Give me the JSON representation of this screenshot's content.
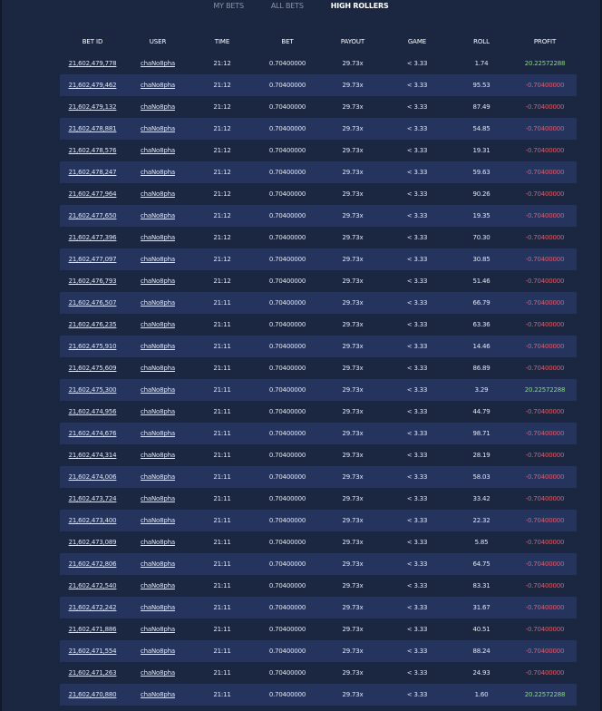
{
  "tabs": [
    {
      "label": "MY BETS",
      "active": false
    },
    {
      "label": "ALL BETS",
      "active": false
    },
    {
      "label": "HIGH ROLLERS",
      "active": true
    }
  ],
  "table": {
    "columns": [
      "BET ID",
      "USER",
      "TIME",
      "BET",
      "PAYOUT",
      "GAME",
      "ROLL",
      "PROFIT"
    ],
    "rows": [
      {
        "bet_id": "21,602,479,778",
        "user": "chaNo8pha",
        "time": "21:12",
        "bet": "0.70400000",
        "payout": "29.73x",
        "game": "< 3.33",
        "roll": "1.74",
        "profit": "20.22572288",
        "win": true
      },
      {
        "bet_id": "21,602,479,462",
        "user": "chaNo8pha",
        "time": "21:12",
        "bet": "0.70400000",
        "payout": "29.73x",
        "game": "< 3.33",
        "roll": "95.53",
        "profit": "-0.70400000",
        "win": false
      },
      {
        "bet_id": "21,602,479,132",
        "user": "chaNo8pha",
        "time": "21:12",
        "bet": "0.70400000",
        "payout": "29.73x",
        "game": "< 3.33",
        "roll": "87.49",
        "profit": "-0.70400000",
        "win": false
      },
      {
        "bet_id": "21,602,478,881",
        "user": "chaNo8pha",
        "time": "21:12",
        "bet": "0.70400000",
        "payout": "29.73x",
        "game": "< 3.33",
        "roll": "54.85",
        "profit": "-0.70400000",
        "win": false
      },
      {
        "bet_id": "21,602,478,576",
        "user": "chaNo8pha",
        "time": "21:12",
        "bet": "0.70400000",
        "payout": "29.73x",
        "game": "< 3.33",
        "roll": "19.31",
        "profit": "-0.70400000",
        "win": false
      },
      {
        "bet_id": "21,602,478,247",
        "user": "chaNo8pha",
        "time": "21:12",
        "bet": "0.70400000",
        "payout": "29.73x",
        "game": "< 3.33",
        "roll": "59.63",
        "profit": "-0.70400000",
        "win": false
      },
      {
        "bet_id": "21,602,477,964",
        "user": "chaNo8pha",
        "time": "21:12",
        "bet": "0.70400000",
        "payout": "29.73x",
        "game": "< 3.33",
        "roll": "90.26",
        "profit": "-0.70400000",
        "win": false
      },
      {
        "bet_id": "21,602,477,650",
        "user": "chaNo8pha",
        "time": "21:12",
        "bet": "0.70400000",
        "payout": "29.73x",
        "game": "< 3.33",
        "roll": "19.35",
        "profit": "-0.70400000",
        "win": false
      },
      {
        "bet_id": "21,602,477,396",
        "user": "chaNo8pha",
        "time": "21:12",
        "bet": "0.70400000",
        "payout": "29.73x",
        "game": "< 3.33",
        "roll": "70.30",
        "profit": "-0.70400000",
        "win": false
      },
      {
        "bet_id": "21,602,477,097",
        "user": "chaNo8pha",
        "time": "21:12",
        "bet": "0.70400000",
        "payout": "29.73x",
        "game": "< 3.33",
        "roll": "30.85",
        "profit": "-0.70400000",
        "win": false
      },
      {
        "bet_id": "21,602,476,793",
        "user": "chaNo8pha",
        "time": "21:12",
        "bet": "0.70400000",
        "payout": "29.73x",
        "game": "< 3.33",
        "roll": "51.46",
        "profit": "-0.70400000",
        "win": false
      },
      {
        "bet_id": "21,602,476,507",
        "user": "chaNo8pha",
        "time": "21:11",
        "bet": "0.70400000",
        "payout": "29.73x",
        "game": "< 3.33",
        "roll": "66.79",
        "profit": "-0.70400000",
        "win": false
      },
      {
        "bet_id": "21,602,476,235",
        "user": "chaNo8pha",
        "time": "21:11",
        "bet": "0.70400000",
        "payout": "29.73x",
        "game": "< 3.33",
        "roll": "63.36",
        "profit": "-0.70400000",
        "win": false
      },
      {
        "bet_id": "21,602,475,910",
        "user": "chaNo8pha",
        "time": "21:11",
        "bet": "0.70400000",
        "payout": "29.73x",
        "game": "< 3.33",
        "roll": "14.46",
        "profit": "-0.70400000",
        "win": false
      },
      {
        "bet_id": "21,602,475,609",
        "user": "chaNo8pha",
        "time": "21:11",
        "bet": "0.70400000",
        "payout": "29.73x",
        "game": "< 3.33",
        "roll": "86.89",
        "profit": "-0.70400000",
        "win": false
      },
      {
        "bet_id": "21,602,475,300",
        "user": "chaNo8pha",
        "time": "21:11",
        "bet": "0.70400000",
        "payout": "29.73x",
        "game": "< 3.33",
        "roll": "3.29",
        "profit": "20.22572288",
        "win": true
      },
      {
        "bet_id": "21,602,474,956",
        "user": "chaNo8pha",
        "time": "21:11",
        "bet": "0.70400000",
        "payout": "29.73x",
        "game": "< 3.33",
        "roll": "44.79",
        "profit": "-0.70400000",
        "win": false
      },
      {
        "bet_id": "21,602,474,676",
        "user": "chaNo8pha",
        "time": "21:11",
        "bet": "0.70400000",
        "payout": "29.73x",
        "game": "< 3.33",
        "roll": "98.71",
        "profit": "-0.70400000",
        "win": false
      },
      {
        "bet_id": "21,602,474,314",
        "user": "chaNo8pha",
        "time": "21:11",
        "bet": "0.70400000",
        "payout": "29.73x",
        "game": "< 3.33",
        "roll": "28.19",
        "profit": "-0.70400000",
        "win": false
      },
      {
        "bet_id": "21,602,474,006",
        "user": "chaNo8pha",
        "time": "21:11",
        "bet": "0.70400000",
        "payout": "29.73x",
        "game": "< 3.33",
        "roll": "58.03",
        "profit": "-0.70400000",
        "win": false
      },
      {
        "bet_id": "21,602,473,724",
        "user": "chaNo8pha",
        "time": "21:11",
        "bet": "0.70400000",
        "payout": "29.73x",
        "game": "< 3.33",
        "roll": "33.42",
        "profit": "-0.70400000",
        "win": false
      },
      {
        "bet_id": "21,602,473,400",
        "user": "chaNo8pha",
        "time": "21:11",
        "bet": "0.70400000",
        "payout": "29.73x",
        "game": "< 3.33",
        "roll": "22.32",
        "profit": "-0.70400000",
        "win": false
      },
      {
        "bet_id": "21,602,473,089",
        "user": "chaNo8pha",
        "time": "21:11",
        "bet": "0.70400000",
        "payout": "29.73x",
        "game": "< 3.33",
        "roll": "5.85",
        "profit": "-0.70400000",
        "win": false
      },
      {
        "bet_id": "21,602,472,806",
        "user": "chaNo8pha",
        "time": "21:11",
        "bet": "0.70400000",
        "payout": "29.73x",
        "game": "< 3.33",
        "roll": "64.75",
        "profit": "-0.70400000",
        "win": false
      },
      {
        "bet_id": "21,602,472,540",
        "user": "chaNo8pha",
        "time": "21:11",
        "bet": "0.70400000",
        "payout": "29.73x",
        "game": "< 3.33",
        "roll": "83.31",
        "profit": "-0.70400000",
        "win": false
      },
      {
        "bet_id": "21,602,472,242",
        "user": "chaNo8pha",
        "time": "21:11",
        "bet": "0.70400000",
        "payout": "29.73x",
        "game": "< 3.33",
        "roll": "31.67",
        "profit": "-0.70400000",
        "win": false
      },
      {
        "bet_id": "21,602,471,886",
        "user": "chaNo8pha",
        "time": "21:11",
        "bet": "0.70400000",
        "payout": "29.73x",
        "game": "< 3.33",
        "roll": "40.51",
        "profit": "-0.70400000",
        "win": false
      },
      {
        "bet_id": "21,602,471,554",
        "user": "chaNo8pha",
        "time": "21:11",
        "bet": "0.70400000",
        "payout": "29.73x",
        "game": "< 3.33",
        "roll": "88.24",
        "profit": "-0.70400000",
        "win": false
      },
      {
        "bet_id": "21,602,471,263",
        "user": "chaNo8pha",
        "time": "21:11",
        "bet": "0.70400000",
        "payout": "29.73x",
        "game": "< 3.33",
        "roll": "24.93",
        "profit": "-0.70400000",
        "win": false
      },
      {
        "bet_id": "21,602,470,880",
        "user": "chaNo8pha",
        "time": "21:11",
        "bet": "0.70400000",
        "payout": "29.73x",
        "game": "< 3.33",
        "roll": "1.60",
        "profit": "20.22572288",
        "win": true
      }
    ]
  },
  "colors": {
    "background": "#1b2740",
    "row_alt": "#24345c",
    "win": "#7fe06a",
    "loss": "#f05565",
    "text": "#e2e6ee"
  }
}
